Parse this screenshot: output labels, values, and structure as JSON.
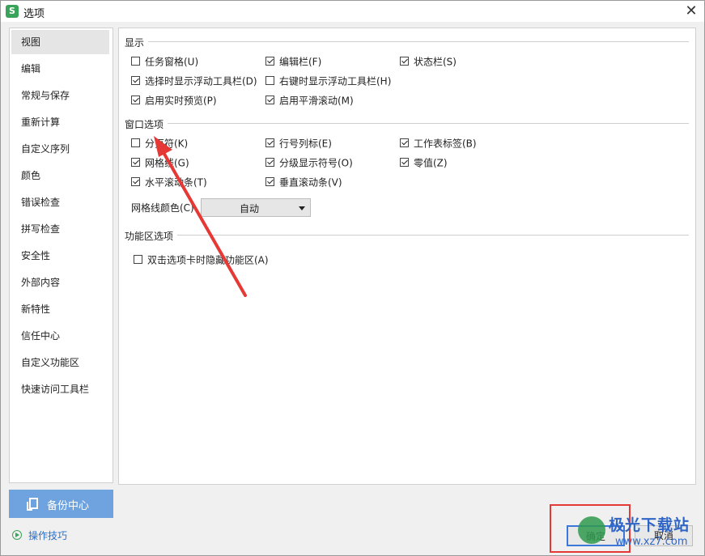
{
  "window": {
    "title": "选项",
    "app_icon_letter": "S"
  },
  "sidebar": {
    "items": [
      {
        "label": "视图",
        "active": true
      },
      {
        "label": "编辑"
      },
      {
        "label": "常规与保存"
      },
      {
        "label": "重新计算"
      },
      {
        "label": "自定义序列"
      },
      {
        "label": "颜色"
      },
      {
        "label": "错误检查"
      },
      {
        "label": "拼写检查"
      },
      {
        "label": "安全性"
      },
      {
        "label": "外部内容"
      },
      {
        "label": "新特性"
      },
      {
        "label": "信任中心"
      },
      {
        "label": "自定义功能区"
      },
      {
        "label": "快速访问工具栏"
      }
    ]
  },
  "sections": {
    "display": {
      "title": "显示",
      "options": [
        {
          "label": "任务窗格(U)",
          "checked": false
        },
        {
          "label": "编辑栏(F)",
          "checked": true
        },
        {
          "label": "状态栏(S)",
          "checked": true
        },
        {
          "label": "选择时显示浮动工具栏(D)",
          "checked": true
        },
        {
          "label": "右键时显示浮动工具栏(H)",
          "checked": false
        },
        {
          "label": "启用实时预览(P)",
          "checked": true
        },
        {
          "label": "启用平滑滚动(M)",
          "checked": true
        }
      ]
    },
    "window_options": {
      "title": "窗口选项",
      "options": [
        {
          "label": "分页符(K)",
          "checked": false
        },
        {
          "label": "行号列标(E)",
          "checked": true
        },
        {
          "label": "工作表标签(B)",
          "checked": true
        },
        {
          "label": "网格线(G)",
          "checked": true
        },
        {
          "label": "分级显示符号(O)",
          "checked": true
        },
        {
          "label": "零值(Z)",
          "checked": true
        },
        {
          "label": "水平滚动条(T)",
          "checked": true
        },
        {
          "label": "垂直滚动条(V)",
          "checked": true
        }
      ],
      "gridline_color_label": "网格线颜色(C)",
      "gridline_color_value": "自动"
    },
    "ribbon": {
      "title": "功能区选项",
      "options": [
        {
          "label": "双击选项卡时隐藏功能区(A)",
          "checked": false
        }
      ]
    }
  },
  "footer": {
    "backup_label": "备份中心",
    "tips_label": "操作技巧",
    "ok_label": "确定",
    "cancel_label": "取消"
  },
  "watermark": {
    "line1": "极光下载站",
    "line2": "www.xz7.com"
  },
  "colors": {
    "accent": "#3b78d8",
    "backup_bg": "#6fa3df",
    "annotation_red": "#e53935",
    "brand_green": "#3aa35a"
  }
}
